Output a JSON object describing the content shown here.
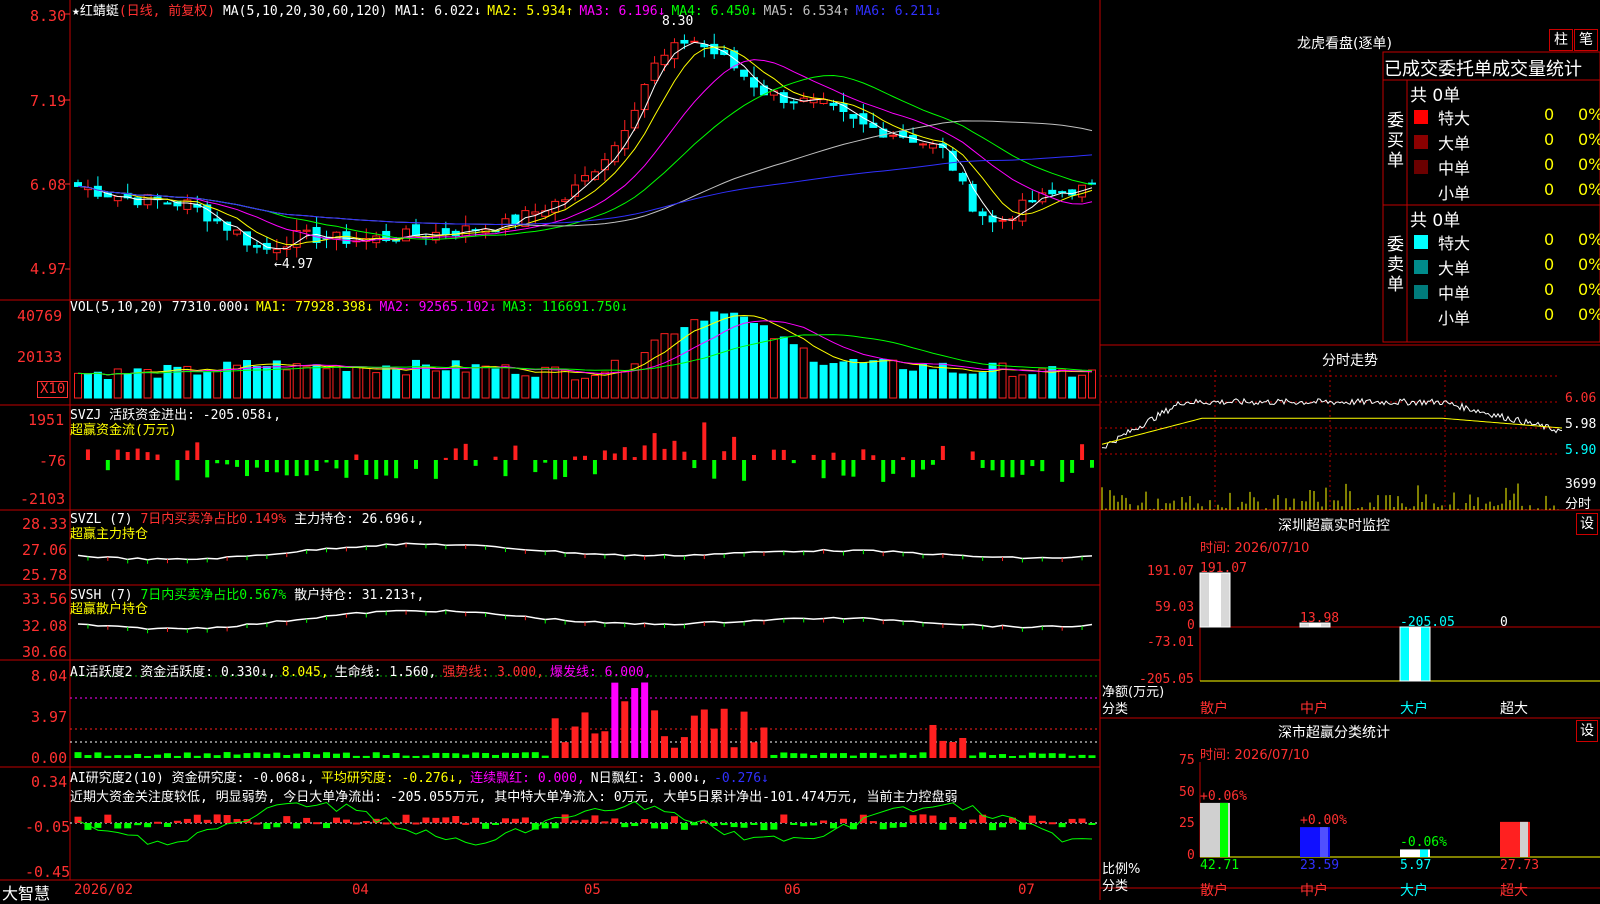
{
  "colors": {
    "up": "#ff2020",
    "down": "#00ffff",
    "grid": "#c00000",
    "axis": "#ff3030",
    "white": "#ffffff",
    "yellow": "#ffff00",
    "magenta": "#ff00ff",
    "green": "#00ff00",
    "blue": "#3030ff",
    "gray": "#c0c0c0"
  },
  "main": {
    "stock_name": "★红蜻蜓",
    "period": "(日线, 前复权)",
    "ma_params": "MA(5,10,20,30,60,120)",
    "ma_items": [
      {
        "label": "MA1: 6.022↓",
        "color": "#ffffff"
      },
      {
        "label": "MA2: 5.934↑",
        "color": "#ffff00"
      },
      {
        "label": "MA3: 6.196↓",
        "color": "#ff00ff"
      },
      {
        "label": "MA4: 6.450↓",
        "color": "#00ff00"
      },
      {
        "label": "MA5: 6.534↑",
        "color": "#c0c0c0"
      },
      {
        "label": "MA6: 6.211↓",
        "color": "#3030ff"
      }
    ],
    "y_ticks": [
      "8.30",
      "7.19",
      "6.08",
      "4.97"
    ],
    "y_tick_values": [
      8.3,
      7.19,
      6.08,
      4.97
    ],
    "high_label": "8.30",
    "low_label": "4.97"
  },
  "volume": {
    "header": "VOL(5,10,20)",
    "items": [
      {
        "label": "77310.000↓",
        "color": "#ffffff"
      },
      {
        "label": "MA1: 77928.398↓",
        "color": "#ffff00"
      },
      {
        "label": "MA2: 92565.102↓",
        "color": "#ff00ff"
      },
      {
        "label": "MA3: 116691.750↓",
        "color": "#00ff00"
      }
    ],
    "y_ticks": [
      "40769",
      "20133"
    ],
    "unit": "X10"
  },
  "svzj": {
    "header": "SVZJ  活跃资金进出: -205.058↓,",
    "sub": "超赢资金流(万元)",
    "y_ticks": [
      "1951",
      "-76",
      "-2103"
    ]
  },
  "svzl": {
    "header_a": "SVZL (7)",
    "header_b": "7日内买卖净占比0.149%",
    "header_c": "主力持仓: 26.696↓,",
    "sub": "超赢主力持仓",
    "y_ticks": [
      "28.33",
      "27.06",
      "25.78"
    ]
  },
  "svsh": {
    "header_a": "SVSH (7)",
    "header_b": "7日内买卖净占比0.567%",
    "header_c": "散户持仓: 31.213↑,",
    "sub": "超赢散户持仓",
    "y_ticks": [
      "33.56",
      "32.08",
      "30.66"
    ]
  },
  "ai1": {
    "items": [
      {
        "label": "AI活跃度2 资金活跃度: 0.330↓,",
        "color": "#ffffff"
      },
      {
        "label": "8.045,",
        "color": "#ffff00"
      },
      {
        "label": "生命线: 1.560,",
        "color": "#ffffff"
      },
      {
        "label": "强势线: 3.000,",
        "color": "#ff3030"
      },
      {
        "label": "爆发线: 6.000,",
        "color": "#ff00ff"
      }
    ],
    "y_ticks": [
      "8.04",
      "3.97",
      "0.00"
    ]
  },
  "ai2": {
    "items": [
      {
        "label": "AI研究度2(10) 资金研究度: -0.068↓,",
        "color": "#ffffff"
      },
      {
        "label": "平均研究度: -0.276↓,",
        "color": "#ffff00"
      },
      {
        "label": "连续飘红: 0.000,",
        "color": "#ff00ff"
      },
      {
        "label": "N日飘红: 3.000↓,",
        "color": "#ffffff"
      },
      {
        "label": "-0.276↓",
        "color": "#3030ff"
      }
    ],
    "comment": "近期大资金关注度较低, 明显弱势, 今日大单净流出: -205.055万元, 其中特大单净流入: 0万元, 大单5日累计净出-101.474万元, 当前主力控盘弱",
    "y_ticks": [
      "0.34",
      "-0.05",
      "-0.45"
    ]
  },
  "x_axis": {
    "brand": "大智慧",
    "labels": [
      "2026/02",
      "04",
      "05",
      "06",
      "07"
    ]
  },
  "right": {
    "lhb_title": "龙虎看盘(逐单)",
    "lhb_btn1": "柱",
    "lhb_btn2": "笔",
    "tabs_line": "已成交委托单成交量统计",
    "buy": {
      "side": "委买单",
      "total": "共 0单",
      "rows": [
        {
          "name": "特大",
          "v": "0",
          "p": "0%",
          "color": "#ff0000"
        },
        {
          "name": "大单",
          "v": "0",
          "p": "0%",
          "color": "#8b0000"
        },
        {
          "name": "中单",
          "v": "0",
          "p": "0%",
          "color": "#6b0000"
        },
        {
          "name": "小单",
          "v": "0",
          "p": "0%",
          "color": ""
        }
      ]
    },
    "sell": {
      "side": "委卖单",
      "total": "共 0单",
      "rows": [
        {
          "name": "特大",
          "v": "0",
          "p": "0%",
          "color": "#00ffff"
        },
        {
          "name": "大单",
          "v": "0",
          "p": "0%",
          "color": "#008b8b"
        },
        {
          "name": "中单",
          "v": "0",
          "p": "0%",
          "color": "#007b7b"
        },
        {
          "name": "小单",
          "v": "0",
          "p": "0%",
          "color": ""
        }
      ]
    },
    "intraday": {
      "title": "分时走势",
      "prices": [
        "6.06",
        "5.98",
        "5.90"
      ],
      "vol": "3699",
      "vol_unit": "分时"
    },
    "monitor": {
      "title": "深圳超赢实时监控",
      "set": "设",
      "time": "时间: 2026/07/10",
      "y_ticks": [
        "191.07",
        "59.03",
        "0",
        "-73.01",
        "-205.05"
      ],
      "values": [
        191.07,
        13.98,
        -205.05,
        0
      ],
      "value_labels": [
        "191.07",
        "13.98",
        "-205.05",
        "0"
      ],
      "cats": [
        "散户",
        "中户",
        "大户",
        "超大"
      ],
      "ylabel": "净额(万元)",
      "xlabel": "分类"
    },
    "classify": {
      "title": "深市超赢分类统计",
      "set": "设",
      "time": "时间: 2026/07/10",
      "y_ticks": [
        "75",
        "50",
        "25",
        "0"
      ],
      "values": [
        42.71,
        23.59,
        5.97,
        27.73
      ],
      "value_labels": [
        "42.71",
        "23.59",
        "5.97",
        "27.73"
      ],
      "changes": [
        "+0.06%",
        "+0.00%",
        "-0.06%",
        ""
      ],
      "cats": [
        "散户",
        "中户",
        "大户",
        "超大"
      ],
      "ylabel": "比例%",
      "xlabel": "分类"
    }
  },
  "chart_data": [
    {
      "type": "bar",
      "title": "深圳超赢实时监控",
      "categories": [
        "散户",
        "中户",
        "大户",
        "超大"
      ],
      "values": [
        191.07,
        13.98,
        -205.05,
        0
      ],
      "ylabel": "净额(万元)",
      "xlabel": "分类",
      "ylim": [
        -205.05,
        191.07
      ]
    },
    {
      "type": "bar",
      "title": "深市超赢分类统计",
      "categories": [
        "散户",
        "中户",
        "大户",
        "超大"
      ],
      "values": [
        42.71,
        23.59,
        5.97,
        27.73
      ],
      "ylabel": "比例%",
      "xlabel": "分类",
      "ylim": [
        0,
        75
      ]
    },
    {
      "type": "line",
      "title": "分时走势",
      "y_ticks": [
        6.06,
        5.98,
        5.9
      ]
    }
  ]
}
